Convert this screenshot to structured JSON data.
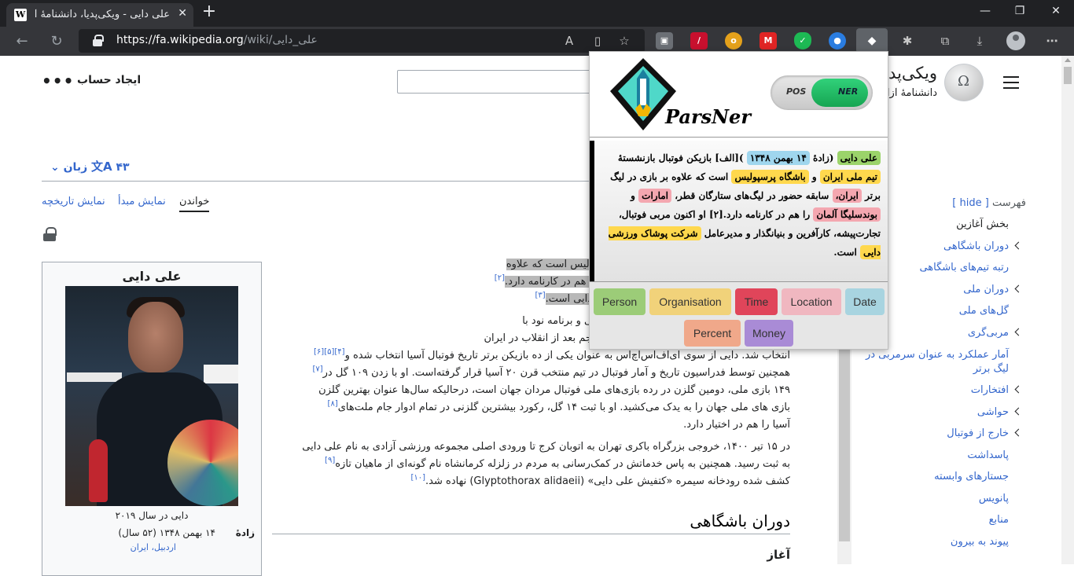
{
  "browser": {
    "tab_title": "علی دایی - ویکی‌پدیا، دانشنامهٔ آزاد",
    "tab_favicon": "W",
    "url_host": "https://fa.wikipedia.org",
    "url_path": "/wiki/علی_دایی",
    "new_tab": "+",
    "close": "✕",
    "minimize": "—",
    "maximize": "❐",
    "window_close": "✕"
  },
  "wiki": {
    "site_name": "ویکی‌پدیا",
    "site_tagline": "دانشنامهٔ آزاد",
    "create_account": "ایجاد حساب",
    "more": "•••",
    "languages": "۴۳ زبان",
    "tabs": {
      "read": "خواندن",
      "source": "نمایش مبدأ",
      "history": "نمایش تاریخچه"
    }
  },
  "infobox": {
    "name": "علی دایی",
    "caption": "دایی در سال ۲۰۱۹",
    "born_label": "زادهٔ",
    "born_value": "۱۴ بهمن ۱۳۴۸ (۵۲ سال)",
    "born_place": "اردبیل، ایران"
  },
  "article": {
    "p1": "فوتبال بازنشستهٔ تیم ملی ایران و باشگاه پرسپولیس است که علاوه",
    "p1b": "های ستارگان قطر، امارات و بوندسلیگا آلمان را هم در کارنامه دارد.",
    "p1c": "و بنیانگذار و مدیرعامل شرکت پوشاک ورزشی دایی است.",
    "s2": "[۲]",
    "s3": "[۳]",
    "p2a": "شمار می‌رود؛ در نظرسنجی‌های سایت ای‌اف‌سی و برنامه نود با",
    "p2b": "مهاجم تاریخ جام ملت‌های آسیا و نیز بهترین مهاجم بعد از انقلاب در ایران",
    "p2c": "انتخاب شد. دایی از سوی ای‌اف‌اس‌اچ‌اس به عنوان یکی از ده بازیکن برتر تاریخ فوتبال آسیا انتخاب شده و",
    "s456": "[۴][۵][۶]",
    "p2d": "همچنین توسط فدراسیون تاریخ و آمار فوتبال در تیم منتخب قرن ۲۰ آسیا قرار گرفته‌است. او با زدن ۱۰۹ گل در",
    "s7": "[۷]",
    "p2e": "۱۴۹ بازی ملی، دومین گلزن در رده بازی‌های ملی فوتبال مردان جهان است، درحالیکه سال‌ها عنوان بهترین گلزن",
    "p2f": "بازی های ملی جهان را به یدک می‌کشید. او با ثبت ۱۴ گل، رکورد بیشترین گلزنی در تمام ادوار جام ملت‌های",
    "s8": "[۸]",
    "p2g": "آسیا را هم در اختیار دارد.",
    "p3a": "در ۱۵ تیر ۱۴۰۰، خروجی بزرگراه باکری تهران به اتوبان کرج تا ورودی اصلی مجموعه ورزشی آزادی به نام علی دایی",
    "p3b": "به ثبت رسید. همچنین به پاس خدماتش در کمک‌رسانی به مردم در زلزله کرمانشاه نام گونه‌ای از ماهیان تازه",
    "s9": "[۹]",
    "p3c": "کشف شده رودخانه سیمره «کتفیش علی دایی» (Glyptothorax alidaeii) نهاده شد.",
    "s10": "[۱۰]",
    "h2": "دوران باشگاهی",
    "h3": "آغاز"
  },
  "toc": {
    "title": "فهرست",
    "hide": "[ hide ]",
    "items": [
      {
        "label": "بخش آغازین",
        "chev": false,
        "plain": true
      },
      {
        "label": "دوران باشگاهی",
        "chev": true
      },
      {
        "label": "رتبه تیم‌های باشگاهی",
        "chev": false
      },
      {
        "label": "دوران ملی",
        "chev": true
      },
      {
        "label": "گل‌های ملی",
        "chev": false
      },
      {
        "label": "مربی‌گری",
        "chev": true
      },
      {
        "label": "آمار عملکرد به عنوان سرمربی در لیگ برتر",
        "chev": false,
        "two": true
      },
      {
        "label": "افتخارات",
        "chev": true
      },
      {
        "label": "حواشی",
        "chev": true
      },
      {
        "label": "خارج از فوتبال",
        "chev": true
      },
      {
        "label": "پاسداشت",
        "chev": false
      },
      {
        "label": "جستارهای وابسته",
        "chev": false
      },
      {
        "label": "پانویس",
        "chev": false
      },
      {
        "label": "منابع",
        "chev": false
      },
      {
        "label": "پیوند به بیرون",
        "chev": false
      }
    ]
  },
  "parsner": {
    "brand": "ParsNer",
    "toggle_off": "POS",
    "toggle_on": "NER",
    "text": {
      "person1": "علی دایی",
      "t1": "(زادهٔ",
      "time1": "۱۴ بهمن ۱۳۴۸",
      "t2": ")[الف] بازیکن فوتبال بازنشستهٔ",
      "org1": "تیم ملی ایران",
      "t3": "و",
      "org2": "باشگاه پرسپولیس",
      "t4": "است که علاوه بر بازی در لیگ برتر",
      "loc1": "ایران،",
      "t5": "سابقه حضور در لیگ‌های ستارگان قطر،",
      "loc2": "امارات",
      "t6": "و",
      "loc3": "بوندسلیگا آلمان",
      "t7": "را هم در کارنامه دارد.[۲] او اکنون مربی فوتبال، تجارت‌پیشه، کارآفرین و بنیانگذار و مدیرعامل",
      "org3": "شرکت پوشاک ورزشی دایی",
      "t8": "است."
    },
    "legend": {
      "person": "Person",
      "organisation": "Organisation",
      "time": "Time",
      "location": "Location",
      "date": "Date",
      "percent": "Percent",
      "money": "Money"
    },
    "colors": {
      "person": "#9bd36a",
      "organisation": "#ffd84d",
      "time": "#9fd6ee",
      "location": "#f4a7b0"
    }
  }
}
